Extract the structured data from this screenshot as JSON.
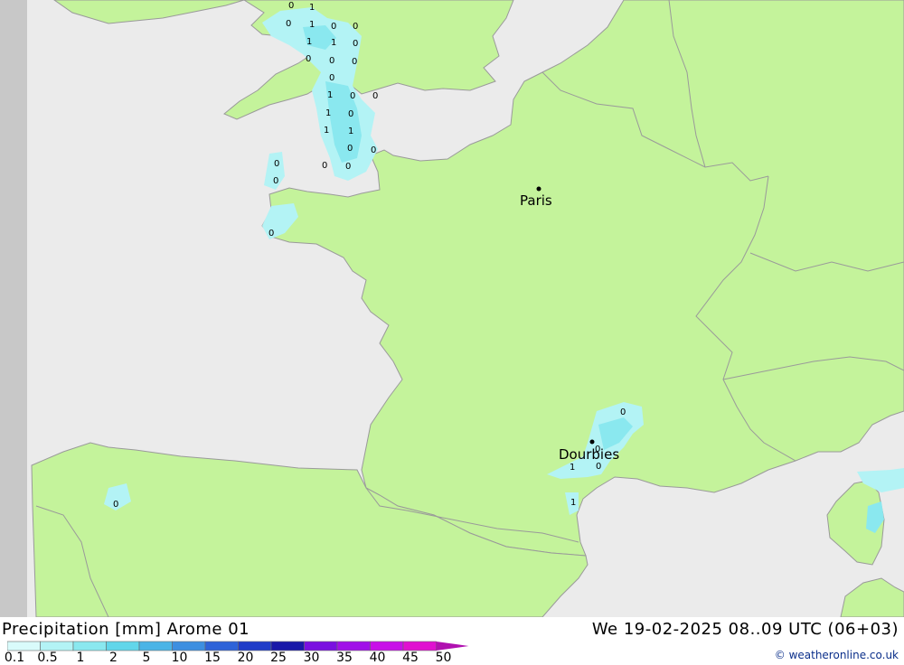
{
  "title": {
    "left": "Precipitation [mm] Arome 01",
    "right": "We 19-02-2025 08..09 UTC (06+03)"
  },
  "credit": "© weatheronline.co.uk",
  "colors": {
    "sea": "#ebebeb",
    "land": "#c4f39b",
    "border": "#9a9a9a",
    "left_strip": "#c8c8c8"
  },
  "legend": {
    "scale": [
      {
        "label": "0.1",
        "color": "#d9fbfb"
      },
      {
        "label": "0.5",
        "color": "#b3f3f5"
      },
      {
        "label": "1",
        "color": "#8ae8ef"
      },
      {
        "label": "2",
        "color": "#62d6ea"
      },
      {
        "label": "5",
        "color": "#4bb4e6"
      },
      {
        "label": "10",
        "color": "#3d8fe0"
      },
      {
        "label": "15",
        "color": "#2e63d8"
      },
      {
        "label": "20",
        "color": "#1f3cc8"
      },
      {
        "label": "25",
        "color": "#1a1aa8"
      },
      {
        "label": "30",
        "color": "#7a10e0"
      },
      {
        "label": "35",
        "color": "#a010e8"
      },
      {
        "label": "40",
        "color": "#c810e8"
      },
      {
        "label": "45",
        "color": "#e010d0"
      },
      {
        "label": "50",
        "color": "#b010b0"
      }
    ]
  },
  "cities": [
    {
      "name": "Paris"
    },
    {
      "name": "Dourbies"
    }
  ],
  "precip_values": [
    "0",
    "1",
    "0",
    "1",
    "0",
    "0",
    "1",
    "1",
    "0",
    "0",
    "0",
    "0",
    "0",
    "1",
    "0",
    "0",
    "1",
    "0",
    "1",
    "1",
    "0",
    "0",
    "0",
    "0",
    "0",
    "0",
    "0",
    "0",
    "0",
    "1",
    "0",
    "1",
    "0"
  ]
}
